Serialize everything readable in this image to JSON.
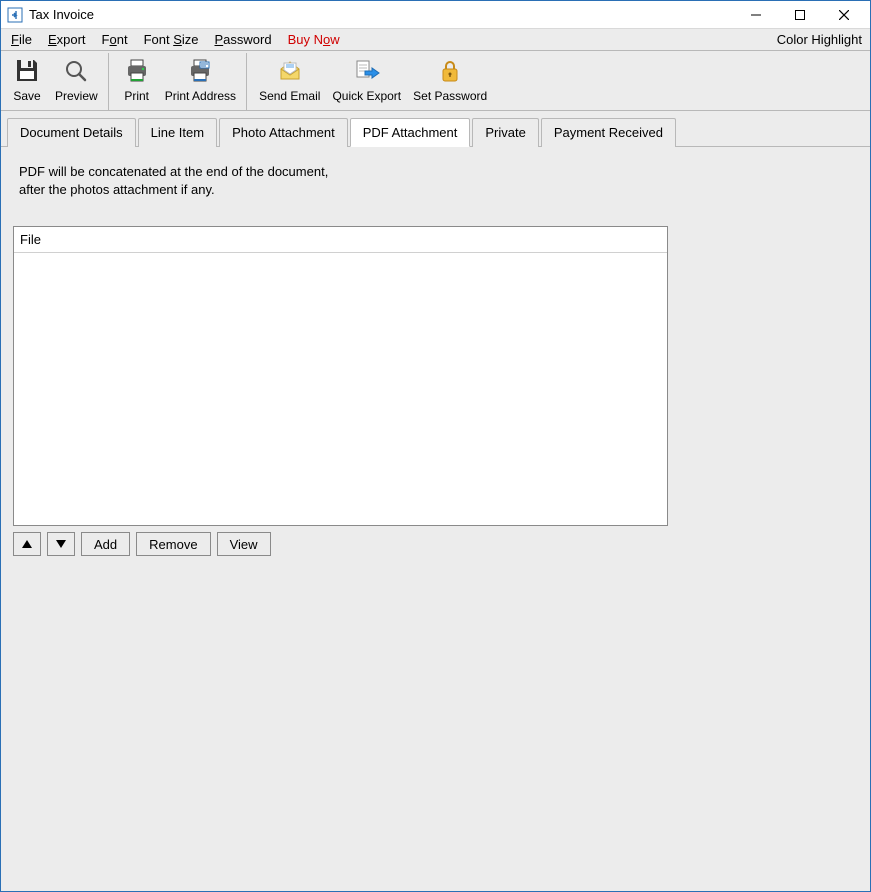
{
  "window": {
    "title": "Tax Invoice"
  },
  "menubar": {
    "items": [
      {
        "label": "File",
        "mnemonic_index": 0
      },
      {
        "label": "Export",
        "mnemonic_index": 0
      },
      {
        "label": "Font",
        "mnemonic_index": 1
      },
      {
        "label": "Font Size",
        "mnemonic_index": 5
      },
      {
        "label": "Password",
        "mnemonic_index": 0
      },
      {
        "label": "Buy Now",
        "mnemonic_index": 5,
        "accent": "red"
      }
    ],
    "right_label": "Color Highlight"
  },
  "toolbar": {
    "groups": [
      {
        "buttons": [
          {
            "id": "save",
            "label": "Save",
            "icon": "floppy-icon"
          },
          {
            "id": "preview",
            "label": "Preview",
            "icon": "magnifier-icon"
          }
        ]
      },
      {
        "buttons": [
          {
            "id": "print",
            "label": "Print",
            "icon": "printer-icon"
          },
          {
            "id": "print-address",
            "label": "Print Address",
            "icon": "printer-label-icon"
          }
        ]
      },
      {
        "buttons": [
          {
            "id": "send-email",
            "label": "Send Email",
            "icon": "envelope-icon"
          },
          {
            "id": "quick-export",
            "label": "Quick Export",
            "icon": "export-arrow-icon"
          },
          {
            "id": "set-password",
            "label": "Set Password",
            "icon": "lock-icon"
          }
        ]
      }
    ]
  },
  "tabs": {
    "items": [
      {
        "id": "document-details",
        "label": "Document Details"
      },
      {
        "id": "line-item",
        "label": "Line Item"
      },
      {
        "id": "photo-attachment",
        "label": "Photo Attachment"
      },
      {
        "id": "pdf-attachment",
        "label": "PDF Attachment"
      },
      {
        "id": "private",
        "label": "Private"
      },
      {
        "id": "payment-received",
        "label": "Payment Received"
      }
    ],
    "active_id": "pdf-attachment"
  },
  "content": {
    "info_line_1": "PDF will be concatenated at the end of the document,",
    "info_line_2": "after the photos attachment if any.",
    "table": {
      "header": "File",
      "rows": []
    },
    "buttons": {
      "add": "Add",
      "remove": "Remove",
      "view": "View"
    }
  }
}
